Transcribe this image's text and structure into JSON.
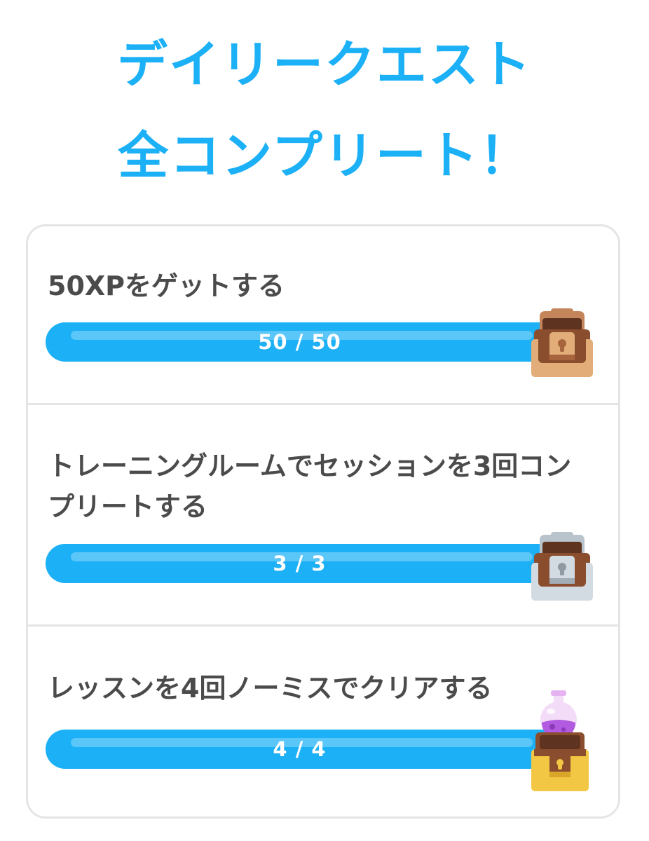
{
  "header": {
    "title_line1": "デイリークエスト",
    "title_line2": "全コンプリート！",
    "color": "#1cb0f6"
  },
  "quests": [
    {
      "title": "50XPをゲットする",
      "progress_label": "50 / 50",
      "current": 50,
      "total": 50,
      "reward_icon": "bronze-chest-icon"
    },
    {
      "title": "トレーニングルームでセッションを3回コンプリートする",
      "progress_label": "3 / 3",
      "current": 3,
      "total": 3,
      "reward_icon": "silver-chest-icon"
    },
    {
      "title": "レッスンを4回ノーミスでクリアする",
      "progress_label": "4 / 4",
      "current": 4,
      "total": 4,
      "reward_icon": "gold-chest-potion-icon"
    }
  ],
  "colors": {
    "progress": "#1cb0f6",
    "text": "#4b4b4b",
    "border": "#e5e5e5"
  }
}
